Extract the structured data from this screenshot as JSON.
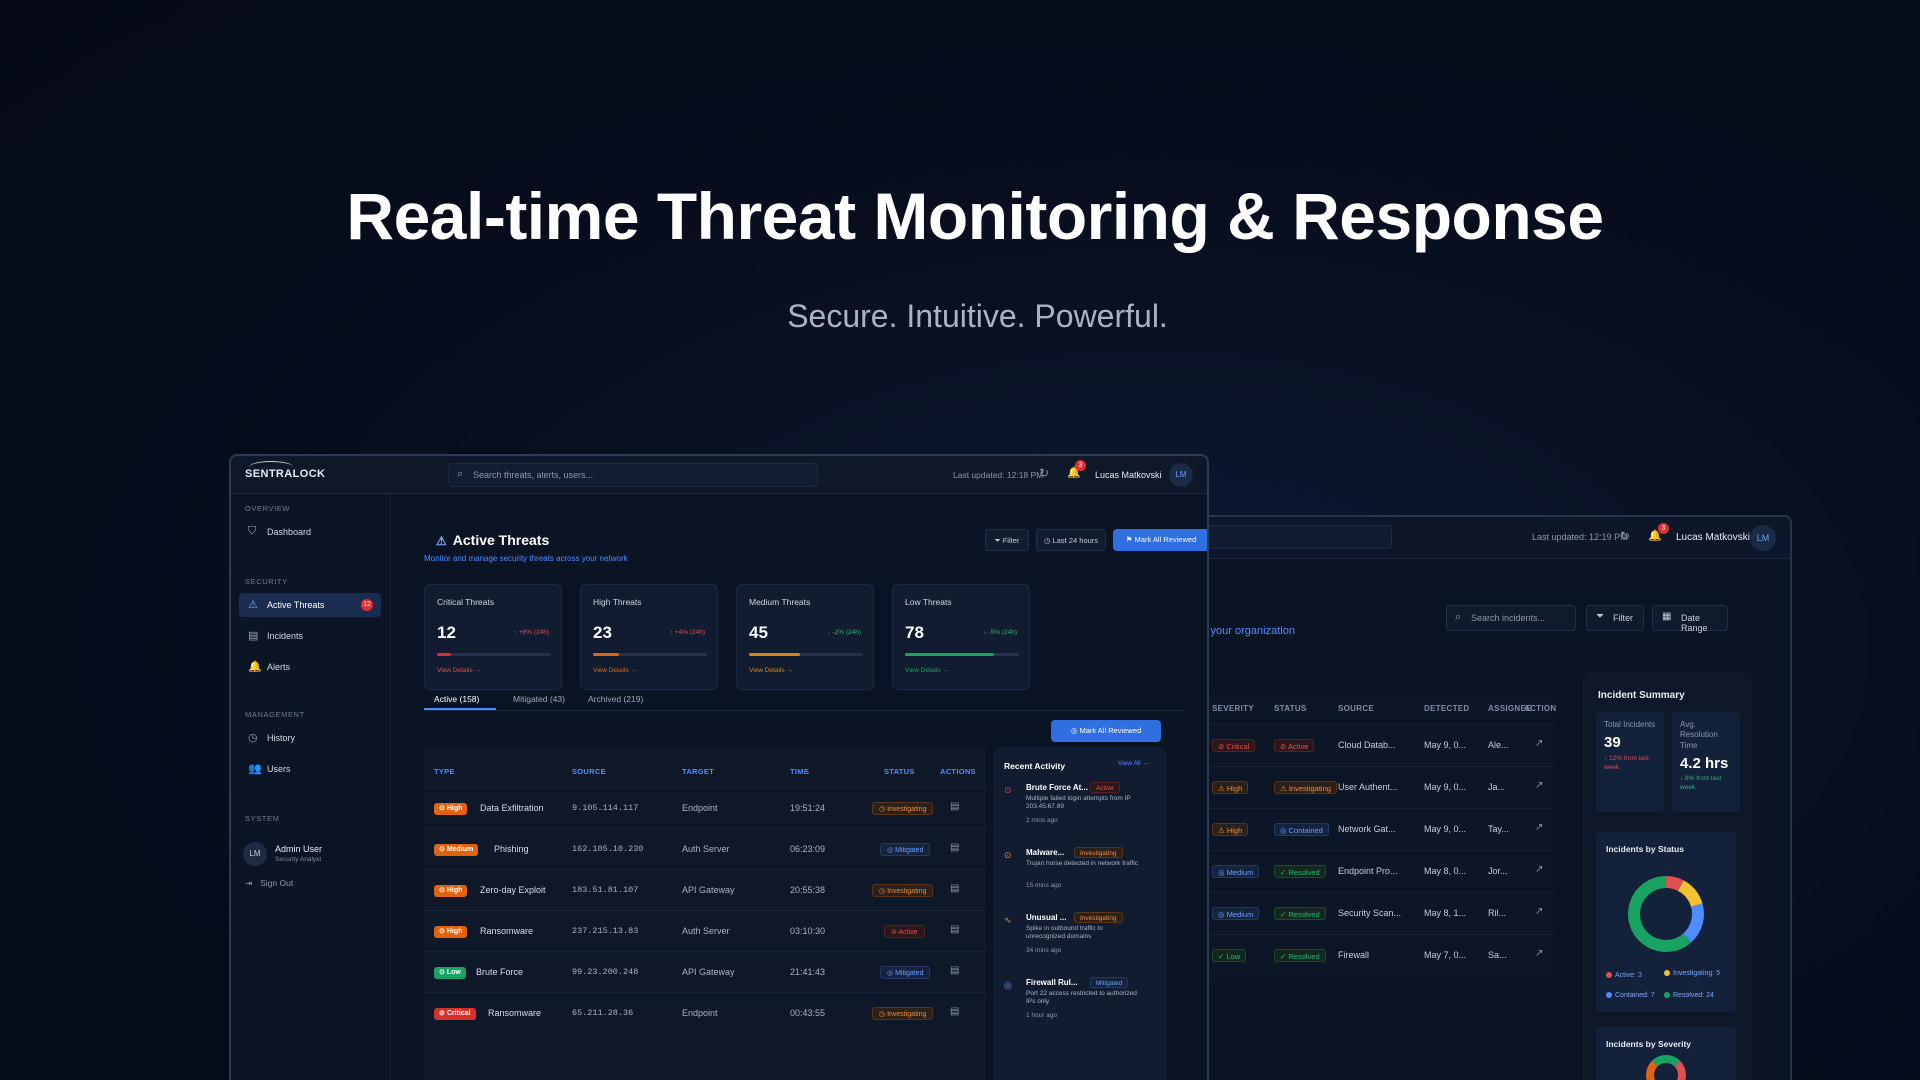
{
  "hero": {
    "title": "Real-time Threat Monitoring & Response",
    "subtitle": "Secure. Intuitive. Powerful."
  },
  "app": {
    "logo": "SENTRALOCK",
    "search_placeholder": "Search threats, alerts, users...",
    "last_updated": "Last updated: 12:18 PM",
    "notification_count": "3",
    "user_name": "Lucas Matkovski",
    "user_initials": "LM"
  },
  "sidebar": {
    "sections": {
      "overview": "OVERVIEW",
      "security": "SECURITY",
      "management": "MANAGEMENT",
      "system": "SYSTEM"
    },
    "items": [
      {
        "label": "Dashboard",
        "icon": "shield-icon"
      },
      {
        "label": "Active Threats",
        "icon": "warning-icon",
        "badge": "12"
      },
      {
        "label": "Incidents",
        "icon": "document-icon"
      },
      {
        "label": "Alerts",
        "icon": "bell-icon"
      },
      {
        "label": "History",
        "icon": "clock-icon"
      },
      {
        "label": "Users",
        "icon": "users-icon"
      }
    ],
    "admin": {
      "initials": "LM",
      "name": "Admin User",
      "role": "Security Analyst"
    },
    "sign_out": "Sign Out"
  },
  "main": {
    "title": "Active Threats",
    "subtitle": "Monitor and manage security threats across your network",
    "filter_label": "Filter",
    "range_label": "Last 24 hours",
    "mark_all_label": "Mark All Reviewed",
    "stats": [
      {
        "label": "Critical Threats",
        "value": "12",
        "change": "+8% (24h)",
        "progress": 0.12,
        "color": "#d9302c",
        "link": "View Details →"
      },
      {
        "label": "High Threats",
        "value": "23",
        "change": "+4% (24h)",
        "progress": 0.23,
        "color": "#e0640f",
        "link": "View Details →"
      },
      {
        "label": "Medium Threats",
        "value": "45",
        "change": "-2% (24h)",
        "progress": 0.45,
        "color": "#e0820f",
        "link": "View Details →"
      },
      {
        "label": "Low Threats",
        "value": "78",
        "change": "-5% (24h)",
        "progress": 0.78,
        "color": "#18a363",
        "link": "View Details →"
      }
    ],
    "tabs": [
      "Active (158)",
      "Mitigated (43)",
      "Archived (219)"
    ],
    "table": {
      "headers": [
        "TYPE",
        "SOURCE",
        "TARGET",
        "TIME",
        "STATUS",
        "ACTIONS"
      ],
      "rows": [
        {
          "severity": "High",
          "type": "Data Exfiltration",
          "source": "9.105.114.117",
          "target": "Endpoint",
          "time": "19:51:24",
          "status": "Investigating"
        },
        {
          "severity": "Medium",
          "type": "Phishing",
          "source": "162.105.10.230",
          "target": "Auth Server",
          "time": "06:23:09",
          "status": "Mitigated"
        },
        {
          "severity": "High",
          "type": "Zero-day Exploit",
          "source": "183.51.81.107",
          "target": "API Gateway",
          "time": "20:55:38",
          "status": "Investigating"
        },
        {
          "severity": "High",
          "type": "Ransomware",
          "source": "237.215.13.83",
          "target": "Auth Server",
          "time": "03:10:30",
          "status": "Active"
        },
        {
          "severity": "Low",
          "type": "Brute Force",
          "source": "99.23.200.248",
          "target": "API Gateway",
          "time": "21:41:43",
          "status": "Mitigated"
        },
        {
          "severity": "Critical",
          "type": "Ransomware",
          "source": "65.211.28.36",
          "target": "Endpoint",
          "time": "00:43:55",
          "status": "Investigating"
        }
      ]
    },
    "activity": {
      "title": "Recent Activity",
      "view_all": "View All →",
      "items": [
        {
          "title": "Brute Force At...",
          "badge": "Active",
          "desc": "Multiple failed login attempts from IP 203.45.67.89",
          "time": "2 mins ago"
        },
        {
          "title": "Malware...",
          "badge": "Investigating",
          "desc": "Trojan horse detected in network traffic",
          "time": "15 mins ago"
        },
        {
          "title": "Unusual ...",
          "badge": "Investigating",
          "desc": "Spike in outbound traffic to unrecognized domains",
          "time": "34 mins ago"
        },
        {
          "title": "Firewall Rul...",
          "badge": "Mitigated",
          "desc": "Port 22 access restricted to authorized IPs only",
          "time": "1 hour ago"
        }
      ]
    }
  },
  "incidents_window": {
    "last_updated": "Last updated: 12:19 PM",
    "notification_count": "3",
    "user_name": "Lucas Matkovski",
    "user_initials": "LM",
    "subtitle_fragment": "s your organization",
    "search_placeholder": "Search incidents...",
    "filter_label": "Filter",
    "date_range_label": "Date Range",
    "table_headers": [
      "SEVERITY",
      "STATUS",
      "SOURCE",
      "DETECTED",
      "ASSIGNEE",
      "ACTION"
    ],
    "rows": [
      {
        "severity": "Critical",
        "status": "Active",
        "source": "Cloud Datab...",
        "detected": "May 9, 0...",
        "assignee": "Ale..."
      },
      {
        "severity": "High",
        "status": "Investigating",
        "source": "User Authent...",
        "detected": "May 9, 0...",
        "assignee": "Ja..."
      },
      {
        "severity": "High",
        "status": "Contained",
        "source": "Network Gat...",
        "detected": "May 9, 0...",
        "assignee": "Tay..."
      },
      {
        "severity": "Medium",
        "status": "Resolved",
        "source": "Endpoint Pro...",
        "detected": "May 8, 0...",
        "assignee": "Jor..."
      },
      {
        "severity": "Medium",
        "status": "Resolved",
        "source": "Security Scan...",
        "detected": "May 8, 1...",
        "assignee": "Ril..."
      },
      {
        "severity": "Low",
        "status": "Resolved",
        "source": "Firewall",
        "detected": "May 7, 0...",
        "assignee": "Sa..."
      }
    ],
    "summary": {
      "title": "Incident Summary",
      "total_label": "Total Incidents",
      "total_value": "39",
      "total_delta": "↑ 12% from last week",
      "resolution_label": "Avg. Resolution Time",
      "resolution_value": "4.2 hrs",
      "resolution_delta": "↓ 8% from last week",
      "status_title": "Incidents by Status",
      "status_legend": [
        {
          "label": "Active: 3",
          "value": 3,
          "color": "#e05050"
        },
        {
          "label": "Investigating: 5",
          "value": 5,
          "color": "#f2c230"
        },
        {
          "label": "Contained: 7",
          "value": 7,
          "color": "#4f8dff"
        },
        {
          "label": "Resolved: 24",
          "value": 24,
          "color": "#18a363"
        }
      ],
      "severity_title": "Incidents by Severity"
    }
  }
}
